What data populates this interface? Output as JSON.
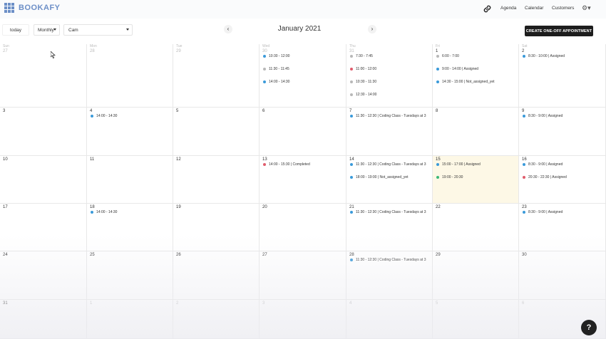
{
  "app": {
    "logo_text": "BOOKAFY"
  },
  "nav": {
    "links": [
      {
        "label": "Agenda"
      },
      {
        "label": "Calendar"
      },
      {
        "label": "Customers"
      }
    ]
  },
  "toolbar": {
    "today_label": "today",
    "view_select": "Monthly",
    "person_select": "Cam",
    "month_title": "January 2021",
    "prev_arrow": "‹",
    "next_arrow": "›",
    "create_button": "CREATE ONE-OFF APPOINTMENT"
  },
  "colors": {
    "blue": "#3a9ad9",
    "red": "#e05c6c",
    "green": "#3cb878",
    "grey": "#b8b8b8",
    "highlight": "#fdf8e6"
  },
  "calendar": {
    "weekday_names": [
      "Sun",
      "Mon",
      "Tue",
      "Wed",
      "Thu",
      "Fri",
      "Sat"
    ],
    "weeks": [
      [
        {
          "num": "27",
          "muted": true,
          "events": []
        },
        {
          "num": "28",
          "muted": true,
          "events": []
        },
        {
          "num": "29",
          "muted": true,
          "events": []
        },
        {
          "num": "30",
          "muted": true,
          "events": [
            {
              "text": "10:30 - 12:00",
              "color": "blue"
            },
            {
              "text": "11:30 - 11:45",
              "color": "grey"
            },
            {
              "text": "14:00 - 14:30",
              "color": "blue"
            }
          ]
        },
        {
          "num": "31",
          "muted": true,
          "events": [
            {
              "text": "7:30 - 7:45",
              "color": "grey"
            },
            {
              "text": "11:00 - 12:00",
              "color": "red"
            },
            {
              "text": "10:30 - 11:30",
              "color": "grey"
            },
            {
              "text": "12:30 - 14:00",
              "color": "grey"
            }
          ]
        },
        {
          "num": "1",
          "muted": false,
          "events": [
            {
              "text": "6:00 - 7:00",
              "color": "grey"
            },
            {
              "text": "9:00 - 14:00 | Assigned",
              "color": "blue"
            },
            {
              "text": "14:30 - 15:00 | Not_assigned_yet",
              "color": "blue"
            }
          ]
        },
        {
          "num": "2",
          "muted": false,
          "events": [
            {
              "text": "8:30 - 10:00 | Assigned",
              "color": "blue"
            }
          ]
        }
      ],
      [
        {
          "num": "3",
          "muted": false,
          "events": []
        },
        {
          "num": "4",
          "muted": false,
          "events": [
            {
              "text": "14:00 - 14:30",
              "color": "blue"
            }
          ]
        },
        {
          "num": "5",
          "muted": false,
          "events": []
        },
        {
          "num": "6",
          "muted": false,
          "events": []
        },
        {
          "num": "7",
          "muted": false,
          "events": [
            {
              "text": "11:30 - 12:30 | Coding Class - Tuesdays at 3",
              "color": "blue"
            }
          ]
        },
        {
          "num": "8",
          "muted": false,
          "events": []
        },
        {
          "num": "9",
          "muted": false,
          "events": [
            {
              "text": "8:30 - 9:00 | Assigned",
              "color": "blue"
            }
          ]
        }
      ],
      [
        {
          "num": "10",
          "muted": false,
          "events": []
        },
        {
          "num": "11",
          "muted": false,
          "events": []
        },
        {
          "num": "12",
          "muted": false,
          "events": []
        },
        {
          "num": "13",
          "muted": false,
          "events": [
            {
              "text": "14:00 - 15:30 | Completed",
              "color": "red"
            }
          ]
        },
        {
          "num": "14",
          "muted": false,
          "events": [
            {
              "text": "11:30 - 12:30 | Coding Class - Tuesdays at 3",
              "color": "blue"
            },
            {
              "text": "18:00 - 19:00 | Not_assigned_yet",
              "color": "blue"
            }
          ]
        },
        {
          "num": "15",
          "muted": false,
          "highlight": true,
          "events": [
            {
              "text": "15:00 - 17:00 | Assigned",
              "color": "blue"
            },
            {
              "text": "19:00 - 20:30",
              "color": "green"
            }
          ]
        },
        {
          "num": "16",
          "muted": false,
          "events": [
            {
              "text": "8:30 - 9:00 | Assigned",
              "color": "blue"
            },
            {
              "text": "20:30 - 22:30 | Assigned",
              "color": "red"
            }
          ]
        }
      ],
      [
        {
          "num": "17",
          "muted": false,
          "events": []
        },
        {
          "num": "18",
          "muted": false,
          "events": [
            {
              "text": "14:00 - 14:30",
              "color": "blue"
            }
          ]
        },
        {
          "num": "19",
          "muted": false,
          "events": []
        },
        {
          "num": "20",
          "muted": false,
          "events": []
        },
        {
          "num": "21",
          "muted": false,
          "events": [
            {
              "text": "11:30 - 12:30 | Coding Class - Tuesdays at 3",
              "color": "blue"
            }
          ]
        },
        {
          "num": "22",
          "muted": false,
          "events": []
        },
        {
          "num": "23",
          "muted": false,
          "events": [
            {
              "text": "8:30 - 9:00 | Assigned",
              "color": "blue"
            }
          ]
        }
      ],
      [
        {
          "num": "24",
          "muted": false,
          "events": []
        },
        {
          "num": "25",
          "muted": false,
          "events": []
        },
        {
          "num": "26",
          "muted": false,
          "events": []
        },
        {
          "num": "27",
          "muted": false,
          "events": []
        },
        {
          "num": "28",
          "muted": false,
          "events": [
            {
              "text": "11:30 - 12:30 | Coding Class - Tuesdays at 3",
              "color": "blue"
            }
          ]
        },
        {
          "num": "29",
          "muted": false,
          "events": []
        },
        {
          "num": "30",
          "muted": false,
          "events": []
        }
      ],
      [
        {
          "num": "31",
          "muted": false,
          "events": []
        },
        {
          "num": "1",
          "muted": true,
          "events": []
        },
        {
          "num": "2",
          "muted": true,
          "events": []
        },
        {
          "num": "3",
          "muted": true,
          "events": []
        },
        {
          "num": "4",
          "muted": true,
          "events": []
        },
        {
          "num": "5",
          "muted": true,
          "events": []
        },
        {
          "num": "6",
          "muted": true,
          "events": []
        }
      ]
    ]
  },
  "help": {
    "label": "?"
  }
}
